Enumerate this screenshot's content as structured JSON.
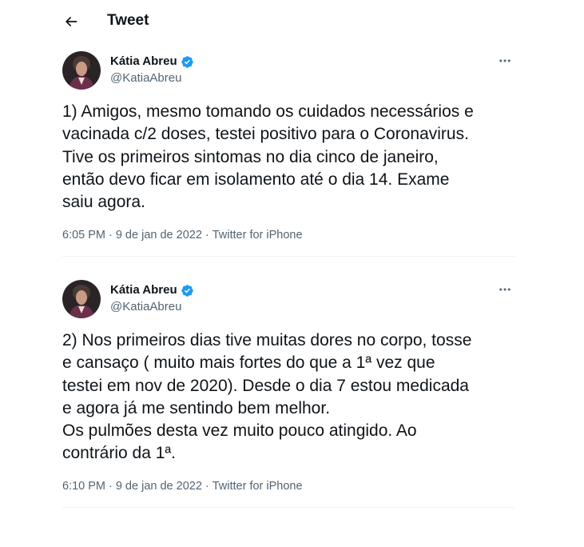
{
  "header": {
    "title": "Tweet",
    "back_icon": "arrow-left-icon"
  },
  "colors": {
    "text": "#0f1419",
    "secondary_text": "#536471",
    "verified_blue": "#1d9bf0",
    "divider": "#eff3f4"
  },
  "tweets": [
    {
      "author": {
        "name": "Kátia Abreu",
        "handle": "@KatiaAbreu",
        "verified": true
      },
      "text": "1) Amigos, mesmo tomando os cuidados necessários e\nvacinada c/2 doses, testei positivo para o Coronavirus.\nTive os primeiros sintomas no dia cinco de janeiro,\nentão devo ficar em isolamento até o dia 14. Exame\nsaiu agora.",
      "time": "6:05 PM",
      "date": "9 de jan de 2022",
      "source": "Twitter for iPhone",
      "separator": "·"
    },
    {
      "author": {
        "name": "Kátia Abreu",
        "handle": "@KatiaAbreu",
        "verified": true
      },
      "text": "2) Nos primeiros dias tive muitas dores no corpo, tosse\ne cansaço ( muito mais fortes do que a 1ª vez que\ntestei em nov de 2020). Desde o dia 7 estou medicada\ne agora já me sentindo bem melhor.\nOs pulmões desta vez muito pouco atingido. Ao\ncontrário da 1ª.",
      "time": "6:10 PM",
      "date": "9 de jan de 2022",
      "source": "Twitter for iPhone",
      "separator": "·"
    }
  ]
}
